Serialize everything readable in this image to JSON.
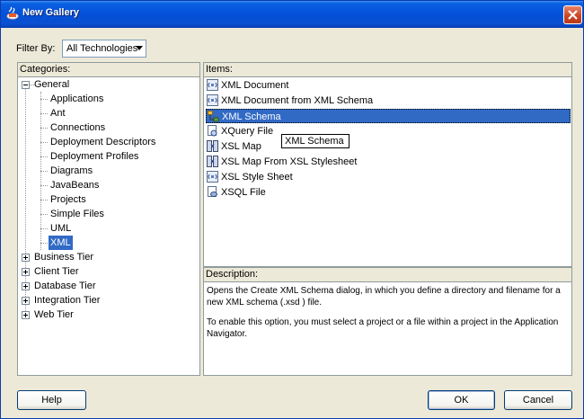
{
  "window": {
    "title": "New Gallery",
    "title_icon": "coffee-cup-icon",
    "close_icon": "close-icon"
  },
  "filter": {
    "label": "Filter By:",
    "value": "All Technologies"
  },
  "categories": {
    "header": "Categories:",
    "general": "General",
    "children": [
      "Applications",
      "Ant",
      "Connections",
      "Deployment Descriptors",
      "Deployment Profiles",
      "Diagrams",
      "JavaBeans",
      "Projects",
      "Simple Files",
      "UML",
      "XML"
    ],
    "selected": "XML",
    "tiers": [
      "Business Tier",
      "Client Tier",
      "Database Tier",
      "Integration Tier",
      "Web Tier"
    ]
  },
  "items": {
    "header": "Items:",
    "list": [
      {
        "label": "XML Document",
        "icon": "xml-document-icon"
      },
      {
        "label": "XML Document from XML Schema",
        "icon": "xml-document-icon"
      },
      {
        "label": "XML Schema",
        "icon": "xml-schema-icon"
      },
      {
        "label": "XQuery File",
        "icon": "xquery-file-icon"
      },
      {
        "label": "XSL Map",
        "icon": "xsl-map-icon"
      },
      {
        "label": "XSL Map From XSL Stylesheet",
        "icon": "xsl-map-icon"
      },
      {
        "label": "XSL Style Sheet",
        "icon": "xml-document-icon"
      },
      {
        "label": "XSQL File",
        "icon": "xsql-file-icon"
      }
    ],
    "selected": "XML Schema",
    "tooltip": "XML Schema"
  },
  "description": {
    "header": "Description:",
    "para1": "Opens the Create XML Schema dialog, in which you define a directory and filename for a new XML schema (.xsd ) file.",
    "para2": "To enable this option, you must select a project or a file within a project in the Application Navigator."
  },
  "buttons": {
    "help": "Help",
    "ok": "OK",
    "cancel": "Cancel"
  },
  "colors": {
    "selection": "#316AC5",
    "titlebar": "#0450D8",
    "dialog_bg": "#ECE9D8"
  }
}
